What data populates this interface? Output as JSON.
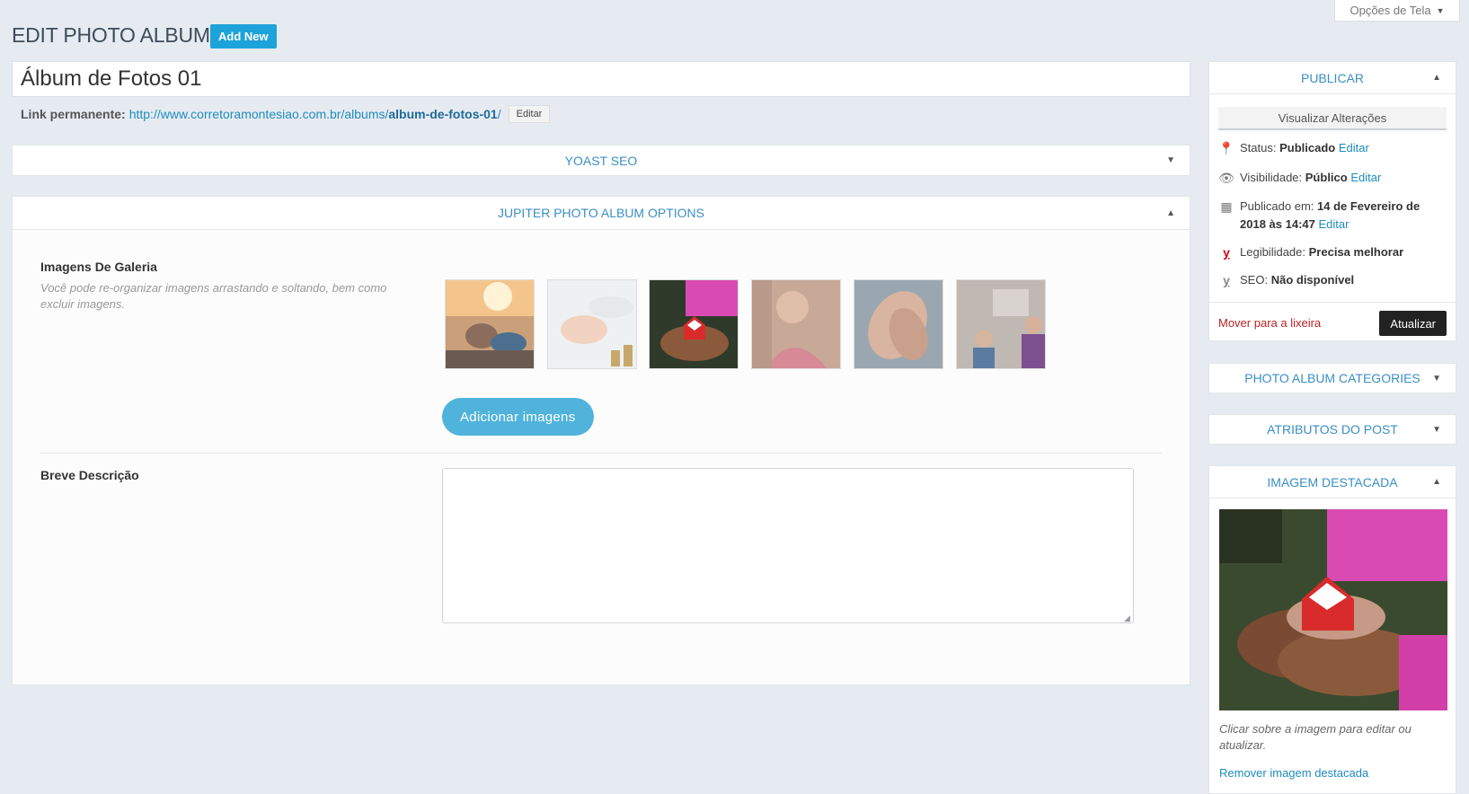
{
  "header": {
    "screen_options": "Opções de Tela",
    "page_title": "EDIT PHOTO ALBUM",
    "add_new": "Add New"
  },
  "post": {
    "title": "Álbum de Fotos 01",
    "permalink_label": "Link permanente:",
    "permalink_base": "http://www.corretoramontesiao.com.br/albums/",
    "permalink_slug": "album-de-fotos-01",
    "permalink_end": "/",
    "permalink_edit": "Editar"
  },
  "panels": {
    "yoast": "YOAST SEO",
    "jupiter": "JUPITER PHOTO ALBUM OPTIONS"
  },
  "gallery": {
    "label": "Imagens De Galeria",
    "description": "Você pode re-organizar imagens arrastando e soltando, bem como excluir imagens.",
    "add_button": "Adicionar imagens",
    "thumbnails": [
      "photo-family-car",
      "photo-hands-coins",
      "photo-hands-red-house",
      "photo-woman-smiling",
      "photo-hands-together",
      "photo-family-home"
    ]
  },
  "brief": {
    "label": "Breve Descrição",
    "value": ""
  },
  "publish": {
    "title": "PUBLICAR",
    "preview": "Visualizar Alterações",
    "status_label": "Status:",
    "status_value": "Publicado",
    "visibility_label": "Visibilidade:",
    "visibility_value": "Público",
    "published_label": "Publicado em:",
    "published_value": "14 de Fevereiro de 2018 às 14:47",
    "readability_label": "Legibilidade:",
    "readability_value": "Precisa melhorar",
    "seo_label": "SEO:",
    "seo_value": "Não disponível",
    "edit": "Editar",
    "trash": "Mover para a lixeira",
    "update": "Atualizar"
  },
  "sidebar": {
    "categories": "PHOTO ALBUM CATEGORIES",
    "attributes": "ATRIBUTOS DO POST",
    "featured": "IMAGEM DESTACADA",
    "featured_hint": "Clicar sobre a imagem para editar ou atualizar.",
    "featured_remove": "Remover imagem destacada"
  },
  "colors": {
    "background": "#e6ebf1",
    "accent": "#1da3d9",
    "link": "#1e8cbe",
    "add_images": "#4fb3dc",
    "danger": "#b22222"
  },
  "icons": [
    "chevron-down-icon",
    "pin-icon",
    "eye-icon",
    "calendar-icon",
    "yoast-icon",
    "resize-handle-icon"
  ]
}
